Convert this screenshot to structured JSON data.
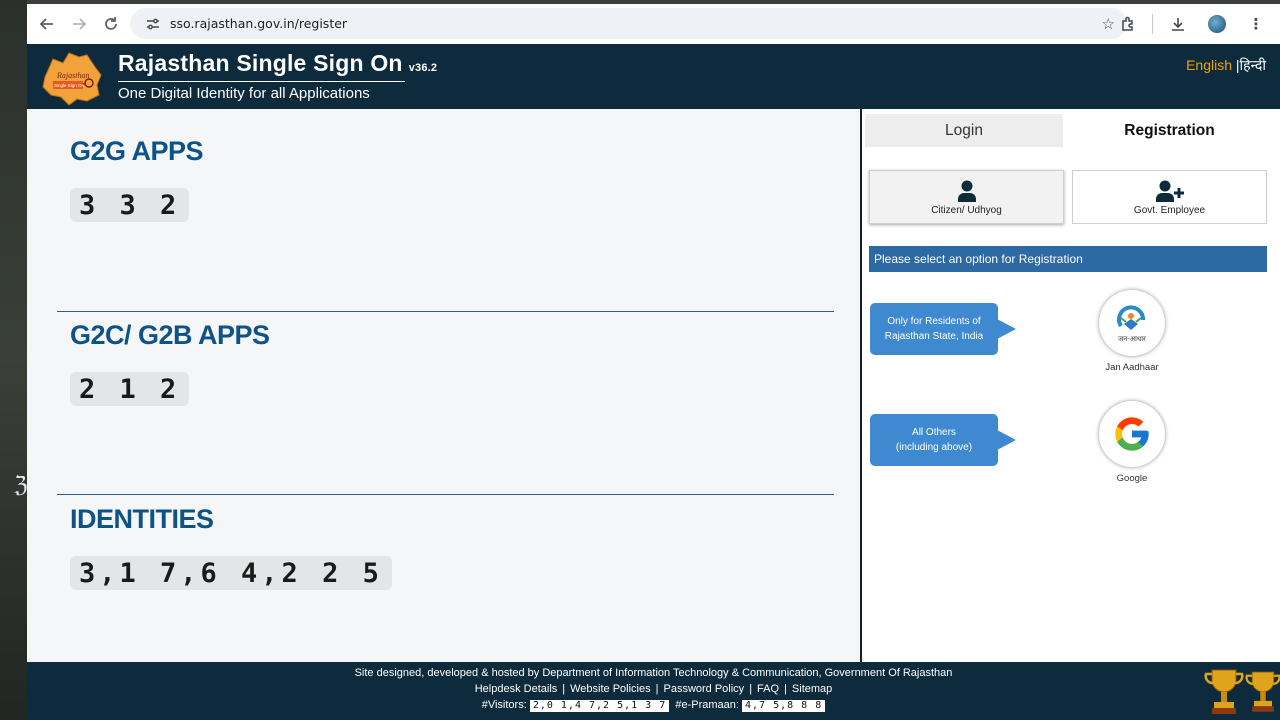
{
  "browser": {
    "url": "sso.rajasthan.gov.in/register",
    "icons": [
      "back-icon",
      "forward-icon",
      "reload-icon",
      "site-info-icon",
      "bookmark-star-icon",
      "extensions-icon",
      "download-icon",
      "profile-icon",
      "menu-icon"
    ]
  },
  "header": {
    "logo_text_1": "Rajasthan",
    "logo_text_2": "Single Sign On",
    "title": "Rajasthan Single Sign On",
    "version": "v36.2",
    "tagline": "One Digital Identity for all Applications",
    "lang_english": "English",
    "lang_sep": "|",
    "lang_hindi": "हिन्दी"
  },
  "stats": [
    {
      "title": "G2G APPS",
      "value": "3 3 2"
    },
    {
      "title": "G2C/ G2B APPS",
      "value": "2 1 2"
    },
    {
      "title": "IDENTITIES",
      "value": "3,1 7,6 4,2 2 5"
    }
  ],
  "registration": {
    "tab_login": "Login",
    "tab_registration": "Registration",
    "option_citizen": "Citizen/ Udhyog",
    "option_govt": "Govt. Employee",
    "notice": "Please select an option for Registration",
    "bubble_residents_1": "Only for Residents of",
    "bubble_residents_2": "Rajasthan State, India",
    "bubble_others_1": "All Others",
    "bubble_others_2": "(including above)",
    "jan_aadhaar_caption": "Jan Aadhaar",
    "jan_aadhaar_logo_text": "जन-आधार",
    "google_caption": "Google"
  },
  "footer": {
    "line1": "Site designed, developed & hosted by Department of Information Technology & Communication, Government Of Rajasthan",
    "links": [
      "Helpdesk Details",
      "Website Policies",
      "Password Policy",
      "FAQ",
      "Sitemap"
    ],
    "link_sep": "|",
    "visitors_label": "#Visitors:",
    "visitors_value": "2,0 1,4 7,2 5,1 3 7",
    "epramaan_label": "#e-Pramaan:",
    "epramaan_value": "4,7 5,8 8 8"
  },
  "colors": {
    "header_bg": "#0d2b3c",
    "stat_title": "#0f5386",
    "notice_bg": "#2d6aa3",
    "bubble_bg": "#3e89cf",
    "lang_active": "#f0a20a"
  }
}
